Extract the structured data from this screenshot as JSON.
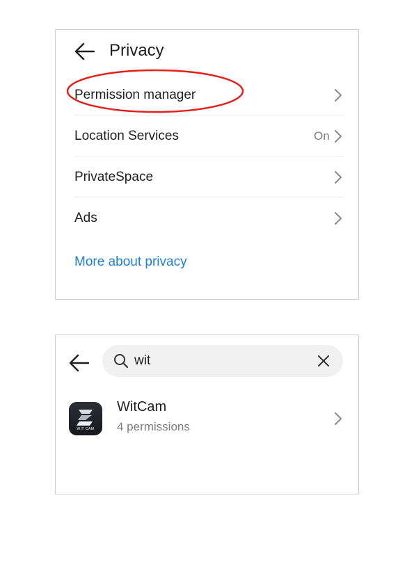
{
  "privacy": {
    "title": "Privacy",
    "items": [
      {
        "label": "Permission manager",
        "value": ""
      },
      {
        "label": "Location Services",
        "value": "On"
      },
      {
        "label": "PrivateSpace",
        "value": ""
      },
      {
        "label": "Ads",
        "value": ""
      }
    ],
    "link": "More about privacy",
    "highlight_color": "#e3201b",
    "link_color": "#1e7fd6"
  },
  "search": {
    "query": "wit",
    "results": [
      {
        "app_name": "WitCam",
        "permissions": "4 permissions",
        "icon_text": "WIT CAM"
      }
    ]
  },
  "icons": {
    "back": "arrow-left-icon",
    "chevron": "chevron-right-icon",
    "search": "magnifier-icon",
    "clear": "close-icon"
  }
}
